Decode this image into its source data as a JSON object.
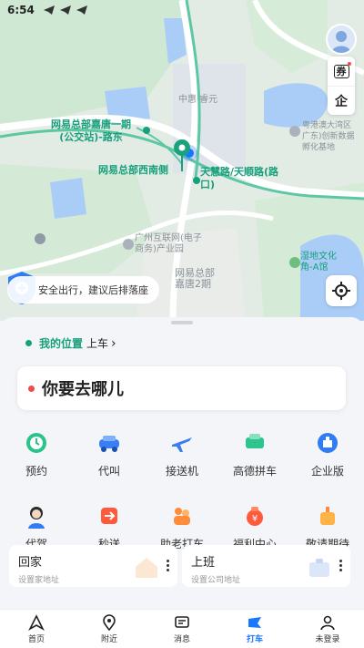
{
  "status_bar": {
    "time": "6:54"
  },
  "map": {
    "labels": {
      "zhonghui": "中惠·睿元",
      "hkmacao": "粤港澳大湾区\n广东)创新数据\n孵化基地",
      "internet_park": "广州互联网(电子\n商务)产业园",
      "wangyi_hq2": "网易总部\n嘉唐2期",
      "wetland": "湿地文化\n角-A馆"
    },
    "routes": {
      "stop_north": "网易总部嘉唐一期\n(公交站)-路东",
      "stop_southwest": "网易总部西南侧",
      "stop_road": "天慧路/天顺路(路\n口)"
    },
    "tools": {
      "coupon_icon": "券",
      "companion_icon": "企"
    },
    "safety_text": "安全出行，建议后排落座"
  },
  "pickup": {
    "dot_label": "我的位置",
    "suffix": "上车",
    "chevron": "›"
  },
  "destination": {
    "placeholder": "你要去哪儿"
  },
  "services": [
    {
      "label": "预约",
      "icon": "clock-icon"
    },
    {
      "label": "代叫",
      "icon": "car-call-icon"
    },
    {
      "label": "接送机",
      "icon": "plane-icon"
    },
    {
      "label": "高德拼车",
      "icon": "carpool-icon"
    },
    {
      "label": "企业版",
      "icon": "enterprise-icon"
    },
    {
      "label": "代驾",
      "icon": "driver-avatar-icon"
    },
    {
      "label": "秒送",
      "icon": "send-icon"
    },
    {
      "label": "助老打车",
      "icon": "elderly-icon"
    },
    {
      "label": "福利中心",
      "icon": "welfare-icon"
    },
    {
      "label": "敬请期待",
      "icon": "gift-icon"
    }
  ],
  "shortcuts": {
    "home": {
      "title": "回家",
      "sub": "设置家地址"
    },
    "work": {
      "title": "上班",
      "sub": "设置公司地址"
    }
  },
  "tabs": [
    {
      "label": "首页",
      "icon": "home-nav-icon"
    },
    {
      "label": "附近",
      "icon": "location-pin-icon"
    },
    {
      "label": "消息",
      "icon": "message-icon"
    },
    {
      "label": "打车",
      "icon": "taxi-icon",
      "active": true
    },
    {
      "label": "未登录",
      "icon": "user-icon"
    }
  ],
  "colors": {
    "accent_green": "#17a07b",
    "accent_blue": "#1677ff",
    "dest_dot": "#f14a4a"
  }
}
